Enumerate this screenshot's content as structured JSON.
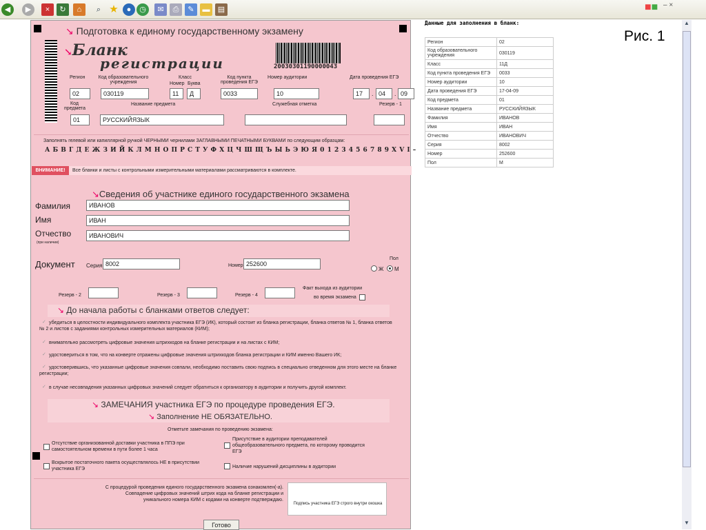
{
  "browser": {
    "toolbar_icons": [
      "back-icon",
      "forward-icon",
      "stop-icon",
      "refresh-icon",
      "home-icon",
      "search-icon",
      "favorites-icon",
      "media-icon",
      "history-icon",
      "mail-icon",
      "print-icon",
      "edit-icon",
      "folder-icon",
      "research-icon"
    ],
    "window_controls": "– ×"
  },
  "form": {
    "header": "Подготовка к единому государственному экзамену",
    "title_line1": "Бланк",
    "title_line2": "регистрации",
    "barcode_number": "20030301190000043",
    "labels": {
      "region": "Регион",
      "school_code": "Код образовательного учреждения",
      "class_num": "Номер",
      "class_letter": "Буква",
      "class": "Класс",
      "exam_point": "Код пункта проведения ЕГЭ",
      "room": "Номер аудитории",
      "date": "Дата проведения ЕГЭ",
      "subject_code": "Код предмета",
      "subject_name": "Название предмета",
      "service": "Служебная отметка",
      "reserve1": "Резерв - 1"
    },
    "values": {
      "region": "02",
      "school_code": "030119",
      "class_num": "11",
      "class_letter": "Д",
      "exam_point": "0033",
      "room": "10",
      "day": "17",
      "month": "04",
      "year": "09",
      "subject_code": "01",
      "subject_name": "РУССКИЙЯЗЫК"
    },
    "sample_text": "Заполнять гелевой или капиллярной ручкой ЧЕРНЫМИ чернилами ЗАГЛАВНЫМИ ПЕЧАТНЫМИ БУКВАМИ по следующим образцам:",
    "sample_chars": "А Б В Г Д Е Ж З И Й К Л М Н О П Р С Т У Ф Х Ц Ч Ш Щ Ъ Ы Ь Э Ю Я 0 1 2 3 4 5 6 7 8 9 X V I –",
    "warning_label": "ВНИМАНИЕ!",
    "warning_text": "Все бланки и листы с контрольными измерительными материалами рассматриваются в комплекте.",
    "participant_title": "Сведения об участнике единого государственного экзамена",
    "surname_label": "Фамилия",
    "surname": "ИВАНОВ",
    "name_label": "Имя",
    "name": "ИВАН",
    "patronymic_label": "Отчество",
    "patronymic_note": "(при наличии)",
    "patronymic": "ИВАНОВИЧ",
    "document_label": "Документ",
    "series_label": "Серия",
    "series": "8002",
    "number_label": "Номер",
    "number": "252600",
    "gender_label": "Пол",
    "gender_f": "Ж",
    "gender_m": "М",
    "reserve2": "Резерв - 2",
    "reserve3": "Резерв - 3",
    "reserve4": "Резерв - 4",
    "exit_fact": "Факт выхода из аудитории",
    "exit_fact2": "во время экзамена",
    "before_title": "До начала работы с бланками ответов следует:",
    "steps": [
      "убедиться в целостности индивидуального комплекта участника ЕГЭ (ИК), который состоит из бланка регистрации, бланка ответов № 1, бланка ответов № 2 и листов с заданиями контрольных измерительных материалов (КИМ);",
      "внимательно рассмотреть цифровые значения штрихкодов на бланке регистрации и на листах с КИМ;",
      "удостовериться в том, что на конверте отражены цифровые значения штрихкодов бланка регистрации и КИМ именно Вашего ИК;",
      "удостоверившись, что указанные цифровые значения совпали, необходимо поставить свою подпись в специально отведенном для этого месте на бланке регистрации;",
      "в случае несовпадения указанных цифровых значений следует обратиться к организатору в аудитории и получить другой комплект."
    ],
    "remarks_title": "ЗАМЕЧАНИЯ участника ЕГЭ по процедуре проведения ЕГЭ.",
    "optional_title": "Заполнение НЕ ОБЯЗАТЕЛЬНО.",
    "mark_remarks": "Отметьте замечания по проведению экзамена:",
    "remarks": [
      "Отсутствие организованной доставки участника в ППЭ при самостоятельном времени в пути более 1 часа",
      "Присутствие в аудитории преподавателей общеобразовательного предмета, по которому проводится ЕГЭ",
      "Вскрытое постаточного пакета осуществлялось НЕ в присутствии участника ЕГЭ",
      "Наличие нарушений дисциплины в аудитории"
    ],
    "agreement": "С процедурой проведения единого государственного экзамена ознакомлен(-а). Совпадение цифровых значений штрих кода на бланке регистрации и уникального номера КИМ с кодами на конверте подтверждаю.",
    "signature_note": "Подпись участника ЕГЭ строго внутри окошка",
    "done_button": "Готово"
  },
  "side": {
    "heading": "Данные для заполнения в бланк:",
    "rows": [
      [
        "Регион",
        "02"
      ],
      [
        "Код образовательного учреждения",
        "030119"
      ],
      [
        "Класс",
        "11Д"
      ],
      [
        "Код пункта проведения ЕГЭ",
        "0033"
      ],
      [
        "Номер аудитории",
        "10"
      ],
      [
        "Дата проведения ЕГЭ",
        "17-04-09"
      ],
      [
        "Код предмета",
        "01"
      ],
      [
        "Название предмета",
        "РУССКИЙЯЗЫК"
      ],
      [
        "Фамилия",
        "ИВАНОВ"
      ],
      [
        "Имя",
        "ИВАН"
      ],
      [
        "Отчество",
        "ИВАНОВИЧ"
      ],
      [
        "Серия",
        "8002"
      ],
      [
        "Номер",
        "252600"
      ],
      [
        "Пол",
        "М"
      ]
    ]
  },
  "figure_label": "Рис. 1"
}
